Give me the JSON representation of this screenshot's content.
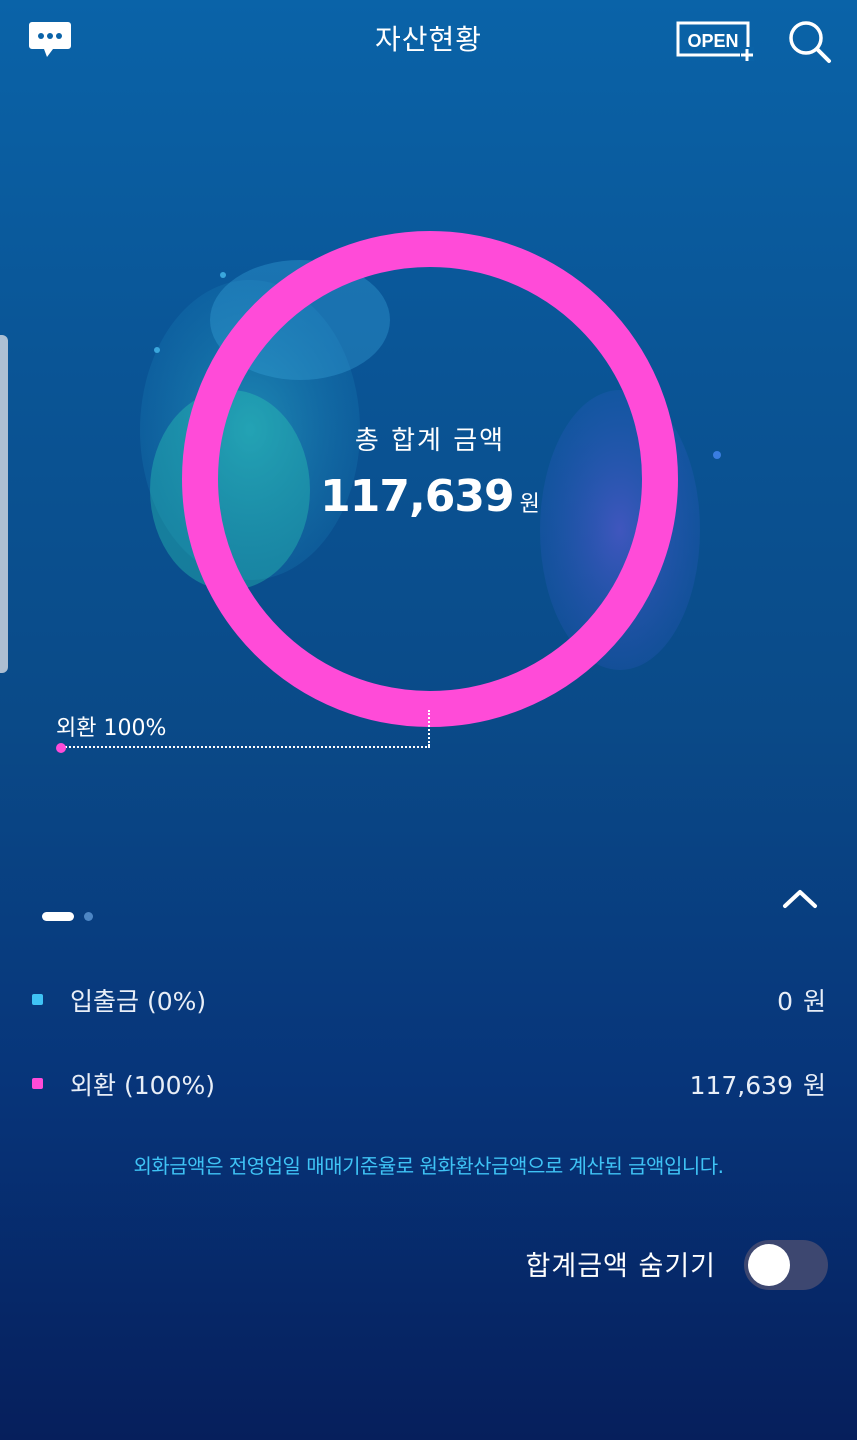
{
  "header": {
    "title": "자산현황",
    "open_label": "OPEN"
  },
  "chart_data": {
    "type": "pie",
    "title": "총 합계 금액",
    "total_value": "117,639",
    "total_unit": "원",
    "slices": [
      {
        "name": "입출금",
        "percent": 0,
        "color": "#3fc3f5"
      },
      {
        "name": "외환",
        "percent": 100,
        "color": "#ff4bd8"
      }
    ],
    "callout": "외환 100%"
  },
  "pager": {
    "count": 2,
    "active": 0
  },
  "legend": [
    {
      "name": "입출금",
      "pct": "(0%)",
      "amount": "0",
      "unit": "원",
      "color": "#3fc3f5"
    },
    {
      "name": "외환",
      "pct": "(100%)",
      "amount": "117,639",
      "unit": "원",
      "color": "#ff4bd8"
    }
  ],
  "notice": "외화금액은 전영업일 매매기준율로 원화환산금액으로 계산된 금액입니다.",
  "hide_total": {
    "label": "합계금액 숨기기",
    "enabled": false
  },
  "colors": {
    "ring": "#ff4bd8",
    "deposit": "#3fc3f5",
    "notice": "#3fc3f5",
    "toggle_off": "#3d4770"
  }
}
